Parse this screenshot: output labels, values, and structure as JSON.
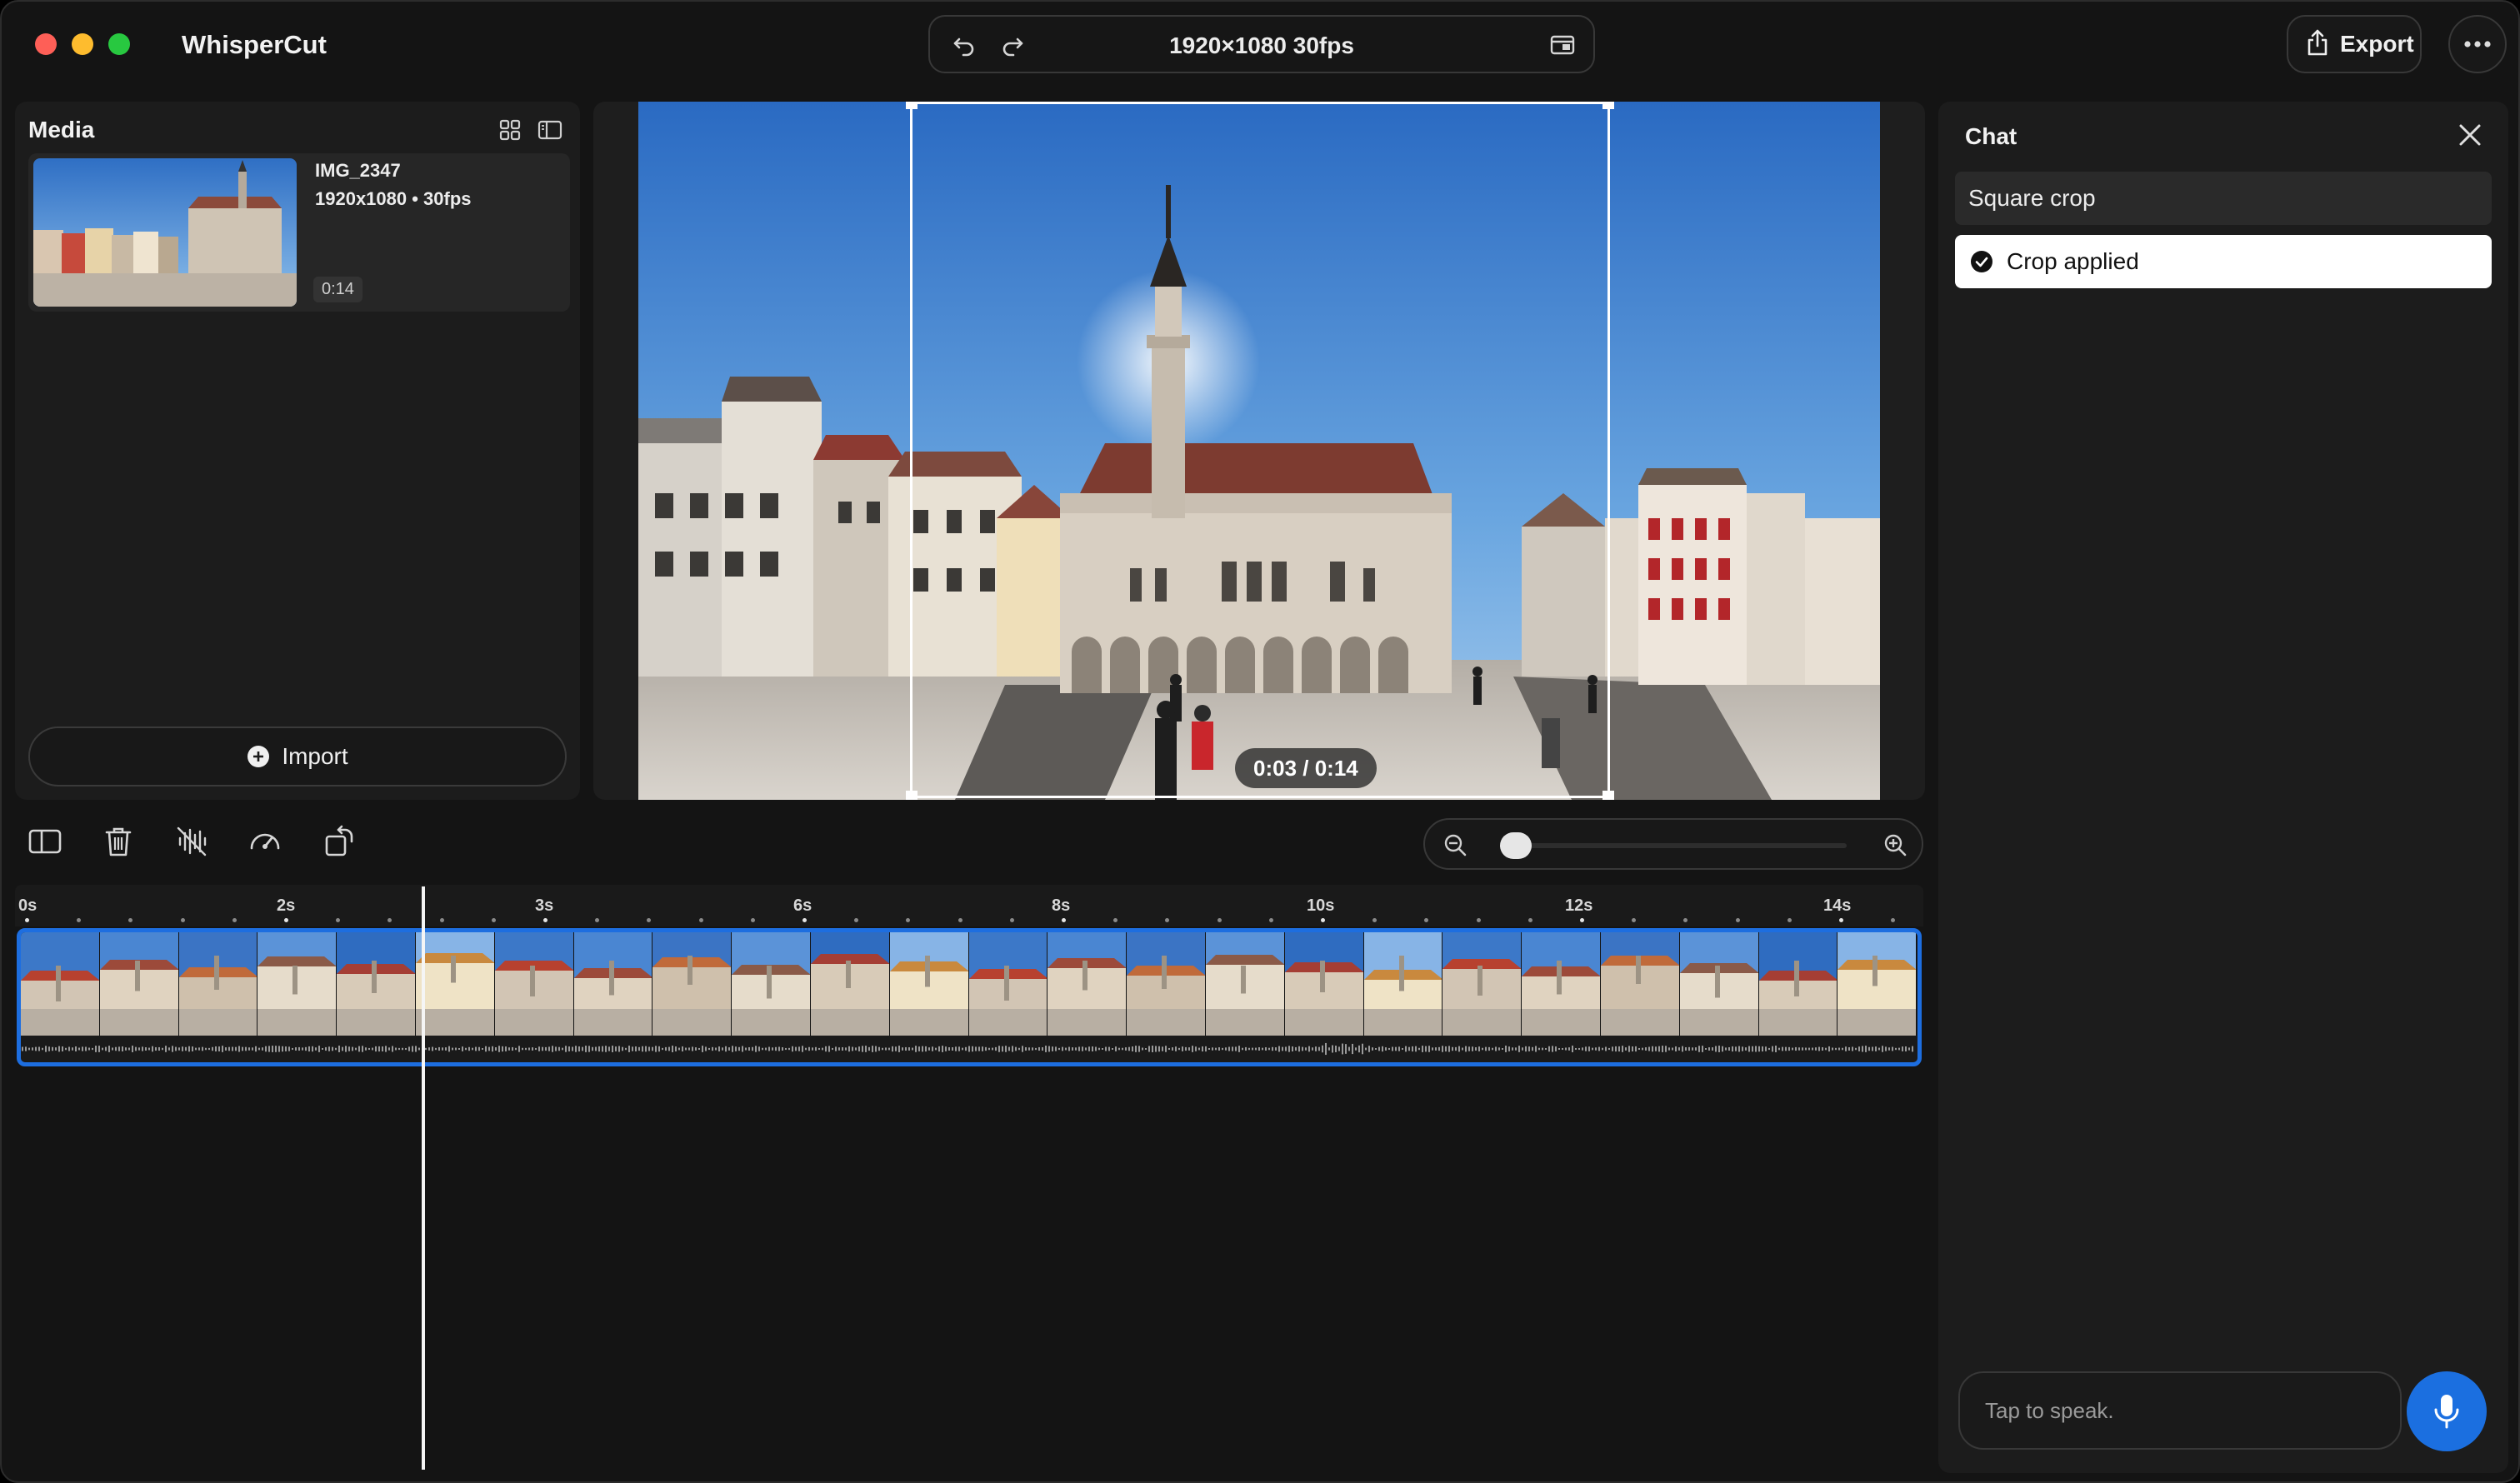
{
  "app": {
    "title": "WhisperCut"
  },
  "header": {
    "resolution_label": "1920×1080 30fps",
    "export_label": "Export"
  },
  "media": {
    "title": "Media",
    "items": [
      {
        "name": "IMG_2347",
        "meta": "1920x1080 • 30fps",
        "duration": "0:14"
      }
    ],
    "import_label": "Import"
  },
  "preview": {
    "time_display": "0:03 / 0:14"
  },
  "chat": {
    "title": "Chat",
    "messages": [
      {
        "role": "user",
        "text": "Square crop"
      },
      {
        "role": "status",
        "text": "Crop applied",
        "icon": "check-circle-icon"
      }
    ],
    "input_placeholder": "Tap to speak."
  },
  "toolbar": {
    "tools": [
      "split-layout-icon",
      "trash-icon",
      "mute-audio-icon",
      "speed-gauge-icon",
      "rotate-icon"
    ],
    "zoom_level": 0.05
  },
  "timeline": {
    "ticks": [
      "0s",
      "2s",
      "3s",
      "6s",
      "8s",
      "10s",
      "12s",
      "14s"
    ],
    "duration_s": 14.6,
    "playhead_time": "0:03"
  },
  "colors": {
    "accent": "#1d6ee0",
    "mic": "#1b6fe0",
    "background": "#141414",
    "panel": "#1c1c1c"
  }
}
